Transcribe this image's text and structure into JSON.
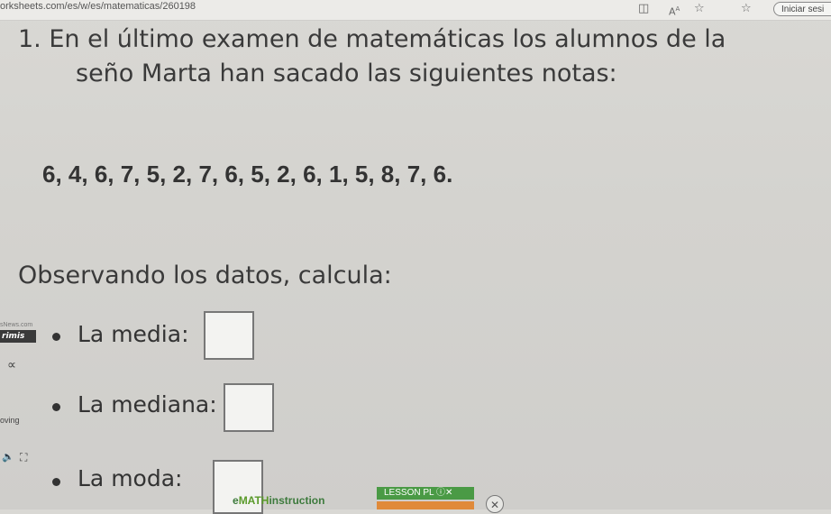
{
  "browser": {
    "url": "orksheets.com/es/w/es/matematicas/260198",
    "login_label": "Iniciar sesi",
    "font_size_label": "A"
  },
  "worksheet": {
    "question_line1": "1. En el último examen de matemáticas los alumnos de la",
    "question_line2": "seño Marta han sacado las siguientes notas:",
    "numbers": "6, 4, 6, 7, 5, 2, 7, 6, 5, 2, 6, 1, 5, 8, 7, 6.",
    "instruction": "Observando los datos, calcula:",
    "items": [
      {
        "label": "La media:"
      },
      {
        "label": "La mediana:"
      },
      {
        "label": "La moda:"
      }
    ]
  },
  "side_widget": {
    "tiny_label": "sNews.com",
    "brand": "rimis",
    "moving_label": "oving"
  },
  "footer": {
    "brand_prefix": "e",
    "brand_bold": "MATH",
    "brand_suffix": "instruction",
    "lesson_label": "LESSON PL"
  },
  "colors": {
    "lesson_green": "#4a9a45",
    "lesson_orange": "#e08a3a",
    "brand_green": "#5a9a2a"
  }
}
